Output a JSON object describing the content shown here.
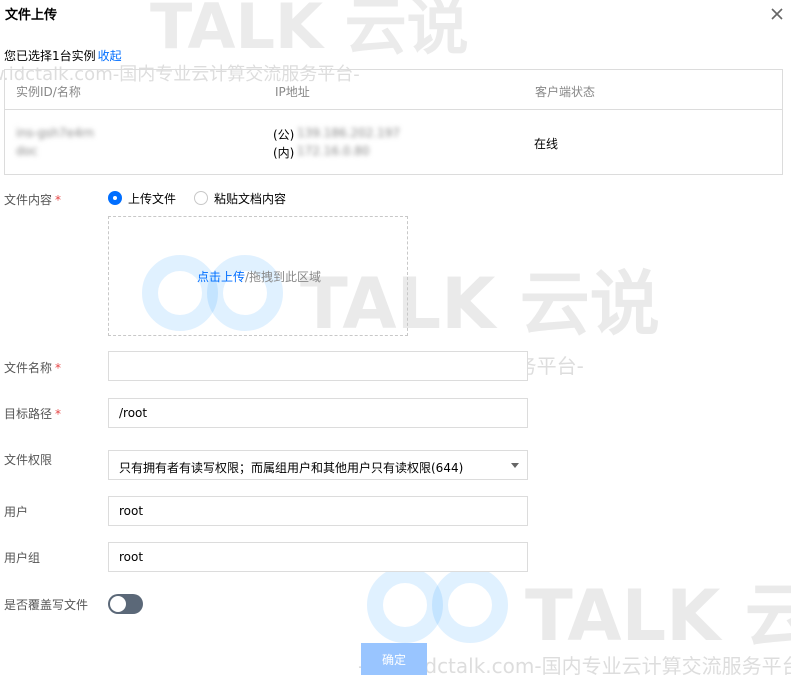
{
  "dialog": {
    "title": "文件上传"
  },
  "selected_info": {
    "text": "您已选择1台实例",
    "collapse_label": "收起"
  },
  "table": {
    "columns": [
      "实例ID/名称",
      "IP地址",
      "客户端状态"
    ],
    "row": {
      "instance_id": "ins-gsh7e4rn",
      "instance_name": "doc",
      "public_ip_prefix": "(公)",
      "public_ip": "139.186.202.197",
      "private_ip_prefix": "(内)",
      "private_ip": "172.16.0.80",
      "status": "在线"
    }
  },
  "form": {
    "content_label": "文件内容",
    "radio_upload_label": "上传文件",
    "radio_paste_label": "粘贴文档内容",
    "upload_link": "点击上传",
    "upload_hint": "/拖拽到此区域",
    "filename_label": "文件名称",
    "filename_value": "",
    "target_path_label": "目标路径",
    "target_path_value": "/root",
    "permission_label": "文件权限",
    "permission_value": "只有拥有者有读写权限；而属组用户和其他用户只有读权限(644)",
    "user_label": "用户",
    "user_value": "root",
    "group_label": "用户组",
    "group_value": "root",
    "overwrite_label": "是否覆盖写文件",
    "overwrite_enabled": false,
    "confirm_label": "确定"
  },
  "watermark": {
    "brand_latin": "TALK",
    "brand_cn": "云说",
    "url_line": "-www.idctalk.com-国内专业云计算交流服务平台-"
  },
  "colors": {
    "accent": "#006eff",
    "required": "#e54545",
    "confirm_disabled": "#99c5ff",
    "toggle_off": "#5b6878"
  }
}
